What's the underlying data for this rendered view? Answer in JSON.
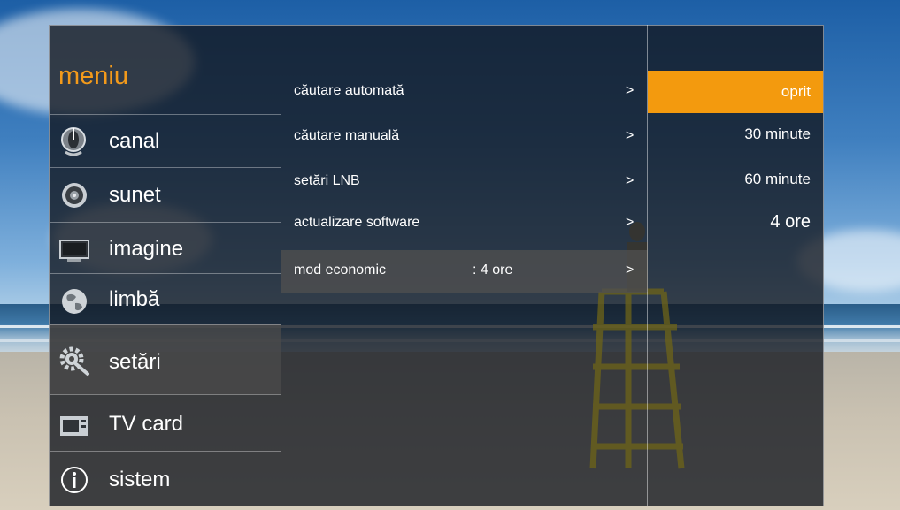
{
  "menu": {
    "title": "meniu",
    "accent_color": "#f39a1b"
  },
  "sidebar": {
    "items": [
      {
        "label": "canal",
        "icon": "satellite-dish-icon"
      },
      {
        "label": "sunet",
        "icon": "speaker-icon"
      },
      {
        "label": "imagine",
        "icon": "monitor-icon"
      },
      {
        "label": "limbă",
        "icon": "globe-icon"
      },
      {
        "label": "setări",
        "icon": "gear-wrench-icon",
        "active": true
      },
      {
        "label": "TV card",
        "icon": "tv-card-icon"
      },
      {
        "label": "sistem",
        "icon": "info-icon"
      }
    ]
  },
  "settings": {
    "rows": [
      {
        "label": "căutare automată",
        "value": "",
        "arrow": ">"
      },
      {
        "label": "căutare manuală",
        "value": "",
        "arrow": ">"
      },
      {
        "label": "setări LNB",
        "value": "",
        "arrow": ">"
      },
      {
        "label": "actualizare software",
        "value": "",
        "arrow": ">"
      },
      {
        "label": "mod economic",
        "value": ": 4 ore",
        "arrow": ">",
        "selected": true
      }
    ]
  },
  "options": {
    "items": [
      {
        "label": "oprit",
        "selected": true
      },
      {
        "label": "30 minute"
      },
      {
        "label": "60 minute"
      },
      {
        "label": "4 ore"
      }
    ],
    "selected_color": "#f39a0e"
  }
}
